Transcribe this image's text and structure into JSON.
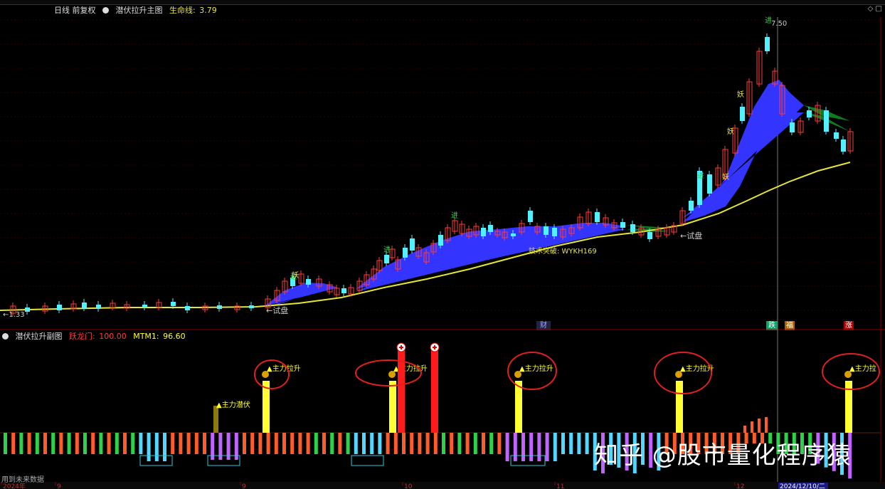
{
  "header": {
    "period": "日线 前复权",
    "indicator_name": "潜伏拉升主图",
    "life_line_label": "生命线:",
    "life_line_value": "3.79",
    "controls": "◇ □"
  },
  "sub_header": {
    "indicator_name": "潜伏拉升副图",
    "dragon_gate_label": "跃龙门:",
    "dragon_gate_value": "100.00",
    "mtm_label": "MTM1:",
    "mtm_value": "96.60"
  },
  "watermark": "知乎 @股市量化程序猿",
  "footnote": "用到未来数据",
  "flags": {
    "cai": "财",
    "die": "跌",
    "fu": "福",
    "zhang": "涨"
  },
  "colors": {
    "up": "#ff3b3b",
    "down": "#53f0ff",
    "ribbon_up": "#3434ff",
    "ribbon_down": "#0f7a1e",
    "life_line": "#e5e538",
    "bar_yellow": "#ffff33",
    "bar_red": "#ff1b1b",
    "circle": "#e0201c"
  },
  "chart_data": [
    {
      "type": "candlestick",
      "title": "潜伏拉升主图",
      "annotations": [
        "←1.33",
        "←试盘",
        "←试盘",
        "技术突破: WYKH169",
        "进",
        "进",
        "进",
        "进",
        "进",
        "妖",
        "妖",
        "妖",
        "妖",
        "7.50"
      ],
      "low_value": "1.33",
      "high_value": "7.50",
      "life_line_value": 3.79
    },
    {
      "type": "bar",
      "title": "潜伏拉升副图",
      "signals": [
        "主力潜伏",
        "主力拉升",
        "主力拉升",
        "主力拉升",
        "主力拉升",
        "主力拉"
      ],
      "dragon_gate": 100.0,
      "mtm1": 96.6
    }
  ],
  "xaxis": {
    "ticks": [
      "2024年",
      "9",
      "9",
      "10",
      "11",
      "12",
      "2024/12/10/二"
    ]
  }
}
